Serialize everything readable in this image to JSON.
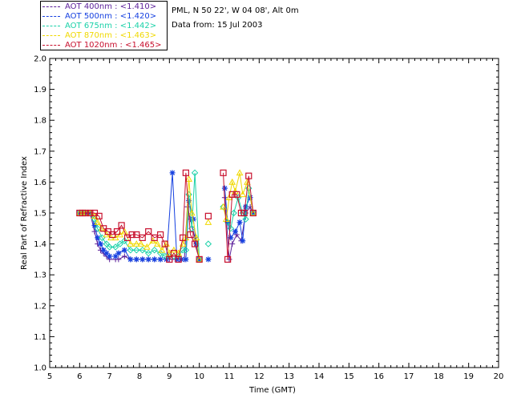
{
  "header": {
    "site_line": "PML, N 50 22', W 04 08', Alt 0m",
    "date_line": "Data from: 15 Jul 2003"
  },
  "legend": [
    {
      "label": "AOT  400nm : <1.410>",
      "color": "#5a1e9a"
    },
    {
      "label": "AOT  500nm : <1.420>",
      "color": "#1540e0"
    },
    {
      "label": "AOT  675nm : <1.442>",
      "color": "#19d1a8"
    },
    {
      "label": "AOT  870nm : <1.463>",
      "color": "#f0d800"
    },
    {
      "label": "AOT 1020nm : <1.465>",
      "color": "#c8102e"
    }
  ],
  "chart_data": {
    "type": "line",
    "title": "",
    "xlabel": "Time (GMT)",
    "ylabel": "Real Part of Refractive Index",
    "xlim": [
      5,
      20
    ],
    "ylim": [
      1.0,
      2.0
    ],
    "xticks": [
      "5",
      "6",
      "7",
      "8",
      "9",
      "10",
      "11",
      "12",
      "13",
      "14",
      "15",
      "16",
      "17",
      "18",
      "19",
      "20"
    ],
    "yticks": [
      "1.0",
      "1.1",
      "1.2",
      "1.3",
      "1.4",
      "1.5",
      "1.6",
      "1.7",
      "1.8",
      "1.9",
      "2.0"
    ],
    "grid": false,
    "legend_position": "top-left outside",
    "series": [
      {
        "name": "AOT  400nm : <1.410>",
        "color": "#5a1e9a",
        "marker": "plus",
        "points": [
          [
            [
              6.0,
              1.5
            ],
            [
              6.1,
              1.5
            ],
            [
              6.2,
              1.5
            ],
            [
              6.35,
              1.5
            ],
            [
              6.5,
              1.44
            ],
            [
              6.6,
              1.4
            ],
            [
              6.7,
              1.38
            ],
            [
              6.8,
              1.37
            ],
            [
              6.9,
              1.36
            ],
            [
              7.0,
              1.35
            ],
            [
              7.2,
              1.35
            ],
            [
              7.3,
              1.35
            ],
            [
              7.5,
              1.36
            ],
            [
              7.7,
              1.35
            ],
            [
              7.9,
              1.35
            ],
            [
              8.1,
              1.35
            ],
            [
              8.3,
              1.35
            ],
            [
              8.5,
              1.35
            ],
            [
              8.7,
              1.35
            ],
            [
              8.9,
              1.35
            ],
            [
              9.0,
              1.35
            ],
            [
              9.2,
              1.35
            ],
            [
              9.35,
              1.35
            ],
            [
              9.5,
              1.35
            ],
            [
              9.6,
              1.52
            ],
            [
              9.7,
              1.48
            ],
            [
              9.85,
              1.42
            ],
            [
              10.0,
              1.35
            ]
          ],
          [
            [
              10.85,
              1.55
            ],
            [
              11.0,
              1.35
            ],
            [
              11.1,
              1.4
            ],
            [
              11.25,
              1.43
            ],
            [
              11.4,
              1.41
            ],
            [
              11.55,
              1.5
            ],
            [
              11.7,
              1.52
            ],
            [
              11.8,
              1.5
            ]
          ]
        ]
      },
      {
        "name": "AOT  500nm : <1.420>",
        "color": "#1540e0",
        "marker": "asterisk",
        "points": [
          [
            [
              6.0,
              1.5
            ],
            [
              6.1,
              1.5
            ],
            [
              6.2,
              1.5
            ],
            [
              6.35,
              1.5
            ],
            [
              6.5,
              1.46
            ],
            [
              6.6,
              1.42
            ],
            [
              6.7,
              1.4
            ],
            [
              6.8,
              1.38
            ],
            [
              6.9,
              1.37
            ],
            [
              7.0,
              1.36
            ],
            [
              7.2,
              1.36
            ],
            [
              7.3,
              1.37
            ],
            [
              7.5,
              1.38
            ],
            [
              7.7,
              1.35
            ],
            [
              7.9,
              1.35
            ],
            [
              8.1,
              1.35
            ],
            [
              8.3,
              1.35
            ],
            [
              8.5,
              1.35
            ],
            [
              8.7,
              1.35
            ],
            [
              8.9,
              1.35
            ],
            [
              9.1,
              1.63
            ],
            [
              9.25,
              1.35
            ],
            [
              9.4,
              1.35
            ],
            [
              9.55,
              1.35
            ],
            [
              9.65,
              1.54
            ],
            [
              9.8,
              1.48
            ],
            [
              9.9,
              1.4
            ],
            [
              10.0,
              1.35
            ]
          ],
          [
            [
              10.3,
              1.35
            ]
          ],
          [
            [
              10.85,
              1.58
            ],
            [
              10.95,
              1.47
            ],
            [
              11.05,
              1.42
            ],
            [
              11.2,
              1.44
            ],
            [
              11.35,
              1.47
            ],
            [
              11.45,
              1.41
            ],
            [
              11.55,
              1.52
            ],
            [
              11.7,
              1.55
            ],
            [
              11.8,
              1.5
            ]
          ]
        ]
      },
      {
        "name": "AOT  675nm : <1.442>",
        "color": "#19d1a8",
        "marker": "diamond",
        "points": [
          [
            [
              6.0,
              1.5
            ],
            [
              6.1,
              1.5
            ],
            [
              6.2,
              1.5
            ],
            [
              6.35,
              1.5
            ],
            [
              6.5,
              1.48
            ],
            [
              6.6,
              1.45
            ],
            [
              6.75,
              1.42
            ],
            [
              6.9,
              1.4
            ],
            [
              7.0,
              1.39
            ],
            [
              7.2,
              1.39
            ],
            [
              7.35,
              1.4
            ],
            [
              7.5,
              1.41
            ],
            [
              7.7,
              1.38
            ],
            [
              7.9,
              1.38
            ],
            [
              8.1,
              1.38
            ],
            [
              8.3,
              1.37
            ],
            [
              8.5,
              1.38
            ],
            [
              8.7,
              1.37
            ],
            [
              8.85,
              1.36
            ],
            [
              9.0,
              1.36
            ],
            [
              9.15,
              1.36
            ],
            [
              9.3,
              1.36
            ],
            [
              9.45,
              1.38
            ],
            [
              9.55,
              1.38
            ],
            [
              9.65,
              1.56
            ],
            [
              9.75,
              1.45
            ],
            [
              9.85,
              1.63
            ],
            [
              10.0,
              1.35
            ]
          ],
          [
            [
              10.3,
              1.4
            ]
          ],
          [
            [
              10.8,
              1.52
            ],
            [
              10.95,
              1.47
            ],
            [
              11.05,
              1.45
            ],
            [
              11.15,
              1.5
            ],
            [
              11.3,
              1.55
            ],
            [
              11.45,
              1.5
            ],
            [
              11.55,
              1.48
            ],
            [
              11.65,
              1.58
            ],
            [
              11.8,
              1.5
            ]
          ]
        ]
      },
      {
        "name": "AOT  870nm : <1.463>",
        "color": "#f0d800",
        "marker": "triangle",
        "points": [
          [
            [
              6.0,
              1.5
            ],
            [
              6.1,
              1.5
            ],
            [
              6.2,
              1.5
            ],
            [
              6.35,
              1.5
            ],
            [
              6.5,
              1.49
            ],
            [
              6.6,
              1.47
            ],
            [
              6.75,
              1.45
            ],
            [
              6.9,
              1.43
            ],
            [
              7.05,
              1.42
            ],
            [
              7.2,
              1.42
            ],
            [
              7.35,
              1.43
            ],
            [
              7.5,
              1.44
            ],
            [
              7.7,
              1.4
            ],
            [
              7.9,
              1.4
            ],
            [
              8.05,
              1.4
            ],
            [
              8.25,
              1.39
            ],
            [
              8.45,
              1.41
            ],
            [
              8.6,
              1.4
            ],
            [
              8.75,
              1.38
            ],
            [
              8.9,
              1.4
            ],
            [
              9.0,
              1.37
            ],
            [
              9.15,
              1.38
            ],
            [
              9.3,
              1.37
            ],
            [
              9.45,
              1.4
            ],
            [
              9.55,
              1.42
            ],
            [
              9.65,
              1.61
            ],
            [
              9.75,
              1.5
            ],
            [
              9.9,
              1.42
            ],
            [
              10.0,
              1.35
            ]
          ],
          [
            [
              10.3,
              1.47
            ]
          ],
          [
            [
              10.8,
              1.52
            ],
            [
              10.9,
              1.48
            ],
            [
              11.0,
              1.55
            ],
            [
              11.1,
              1.6
            ],
            [
              11.2,
              1.57
            ],
            [
              11.35,
              1.63
            ],
            [
              11.45,
              1.56
            ],
            [
              11.6,
              1.6
            ],
            [
              11.8,
              1.5
            ]
          ]
        ]
      },
      {
        "name": "AOT 1020nm : <1.465>",
        "color": "#c8102e",
        "marker": "square",
        "points": [
          [
            [
              6.0,
              1.5
            ],
            [
              6.1,
              1.5
            ],
            [
              6.2,
              1.5
            ],
            [
              6.35,
              1.5
            ],
            [
              6.5,
              1.5
            ],
            [
              6.65,
              1.49
            ],
            [
              6.8,
              1.45
            ],
            [
              6.95,
              1.44
            ],
            [
              7.1,
              1.43
            ],
            [
              7.25,
              1.44
            ],
            [
              7.4,
              1.46
            ],
            [
              7.6,
              1.42
            ],
            [
              7.75,
              1.43
            ],
            [
              7.9,
              1.43
            ],
            [
              8.1,
              1.42
            ],
            [
              8.3,
              1.44
            ],
            [
              8.5,
              1.42
            ],
            [
              8.7,
              1.43
            ],
            [
              8.85,
              1.4
            ],
            [
              9.0,
              1.35
            ],
            [
              9.15,
              1.37
            ],
            [
              9.3,
              1.35
            ],
            [
              9.45,
              1.42
            ],
            [
              9.55,
              1.63
            ],
            [
              9.7,
              1.43
            ],
            [
              9.85,
              1.4
            ],
            [
              10.0,
              1.35
            ]
          ],
          [
            [
              10.3,
              1.49
            ]
          ],
          [
            [
              10.8,
              1.63
            ],
            [
              10.95,
              1.35
            ],
            [
              11.1,
              1.56
            ],
            [
              11.25,
              1.56
            ],
            [
              11.4,
              1.5
            ],
            [
              11.5,
              1.5
            ],
            [
              11.65,
              1.62
            ],
            [
              11.8,
              1.5
            ]
          ]
        ]
      }
    ]
  }
}
